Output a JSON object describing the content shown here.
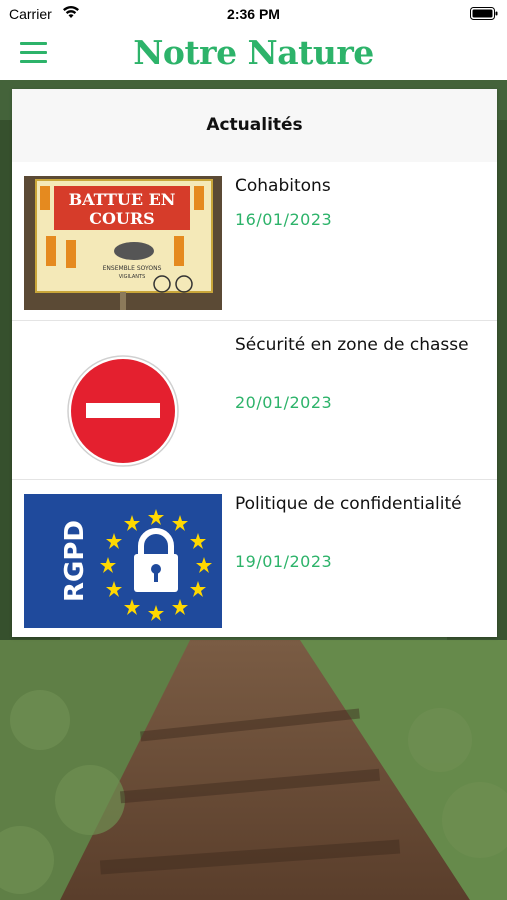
{
  "status_bar": {
    "carrier": "Carrier",
    "time": "2:36 PM",
    "wifi_icon": "wifi-icon",
    "battery_icon": "battery-icon"
  },
  "app": {
    "title": "Notre Nature",
    "menu_icon": "hamburger-menu-icon",
    "accent_color": "#2db36a"
  },
  "news": {
    "header": "Actualités",
    "items": [
      {
        "title": "Cohabitons",
        "date": "16/01/2023",
        "image_text_line1": "BATTUE EN",
        "image_text_line2": "COURS",
        "image_caption_line1": "ENSEMBLE SOYONS",
        "image_caption_line2": "VIGILANTS"
      },
      {
        "title": "Sécurité en zone de chasse",
        "date": "20/01/2023",
        "image_icon": "no-entry-sign-icon"
      },
      {
        "title": "Politique de confidentialité",
        "date": "19/01/2023",
        "image_text": "RGPD",
        "image_icon": "padlock-icon"
      }
    ]
  }
}
